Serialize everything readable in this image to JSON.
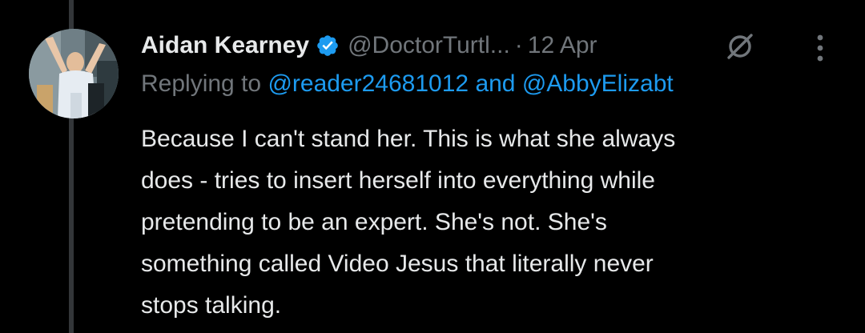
{
  "author": {
    "display_name": "Aidan Kearney",
    "handle": "@DoctorTurtl...",
    "separator": "·",
    "timestamp": "12 Apr",
    "verified_icon": "verified-badge-icon"
  },
  "reply_context": {
    "prefix": "Replying to",
    "mention_1": "@reader24681012",
    "conjunction": "and",
    "mention_2": "@AbbyElizabt"
  },
  "tweet": {
    "lines": [
      "Because I can't stand her. This is what she always",
      "does - tries to insert herself into everything while",
      "pretending to be an expert. She's not. She's",
      "something called Video Jesus that literally never",
      "stops talking."
    ]
  },
  "actions": {
    "grok_icon": "grok-icon",
    "more_icon": "more-vertical-icon"
  },
  "colors": {
    "background": "#000000",
    "text_primary": "#e7e9ea",
    "text_secondary": "#71767b",
    "accent": "#1d9bf0",
    "thread_line": "#333639"
  }
}
